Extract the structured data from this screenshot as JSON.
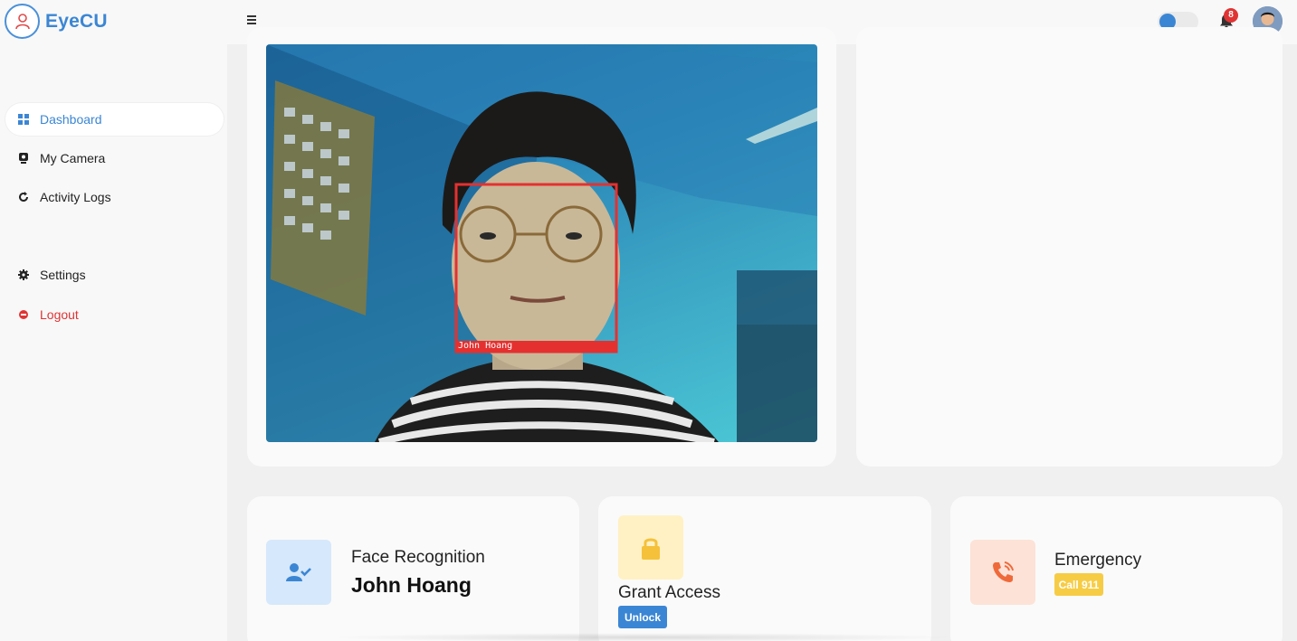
{
  "brand": {
    "name": "EyeCU",
    "logo_icon": "user-scan-icon",
    "accent": "#3b86d4"
  },
  "header": {
    "menu_icon": "hamburger-icon",
    "theme_toggle_on": false,
    "notifications_icon": "bell-icon",
    "notification_count": "8"
  },
  "sidebar": {
    "items": [
      {
        "label": "Dashboard",
        "icon": "grid-icon",
        "active": true
      },
      {
        "label": "My Camera",
        "icon": "webcam-icon"
      },
      {
        "label": "Activity Logs",
        "icon": "refresh-icon"
      },
      {
        "label": "Settings",
        "icon": "gear-icon"
      },
      {
        "label": "Logout",
        "icon": "logout-icon",
        "color": "#e03434"
      }
    ]
  },
  "camera": {
    "detected_label": "John Hoang",
    "box_color": "#e53030"
  },
  "stats": {
    "face_recognition": {
      "title": "Face Recognition",
      "value": "John Hoang",
      "icon": "user-check-icon"
    },
    "grant_access": {
      "title": "Grant Access",
      "button": "Unlock",
      "icon": "lock-icon"
    },
    "emergency": {
      "title": "Emergency",
      "button": "Call 911",
      "icon": "phone-call-icon"
    }
  }
}
